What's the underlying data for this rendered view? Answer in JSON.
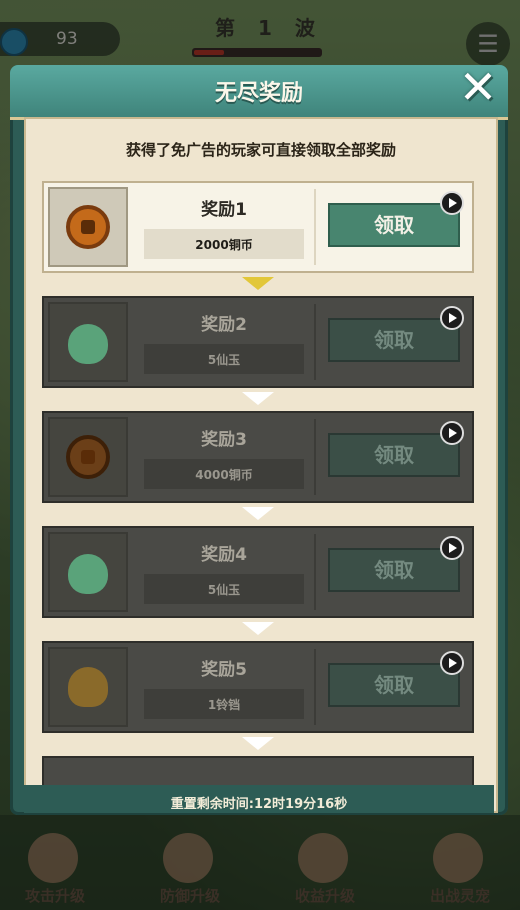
{
  "hud": {
    "resource_value": "93",
    "wave_label": "第 1 波"
  },
  "panel": {
    "title": "无尽奖励",
    "subtitle": "获得了免广告的玩家可直接领取全部奖励",
    "reset_text": "重置剩余时间:12时19分16秒"
  },
  "rewards": [
    {
      "name": "奖励1",
      "amount": "2000铜币",
      "button": "领取",
      "icon": "copper-coin-icon",
      "state": "available"
    },
    {
      "name": "奖励2",
      "amount": "5仙玉",
      "button": "领取",
      "icon": "jade-bag-icon",
      "state": "locked"
    },
    {
      "name": "奖励3",
      "amount": "4000铜币",
      "button": "领取",
      "icon": "copper-coin-icon",
      "state": "locked"
    },
    {
      "name": "奖励4",
      "amount": "5仙玉",
      "button": "领取",
      "icon": "jade-bag-icon",
      "state": "locked"
    },
    {
      "name": "奖励5",
      "amount": "1铃铛",
      "button": "领取",
      "icon": "bell-icon",
      "state": "locked"
    }
  ],
  "nav": [
    {
      "label": "攻击升级",
      "icon": "sword-icon"
    },
    {
      "label": "防御升级",
      "icon": "shield-icon"
    },
    {
      "label": "收益升级",
      "icon": "gold-pot-icon"
    },
    {
      "label": "出战灵宠",
      "icon": "pet-icon"
    }
  ],
  "colors": {
    "accent": "#48856f",
    "panel": "#2d5c55",
    "parchment": "#efe5cf"
  }
}
